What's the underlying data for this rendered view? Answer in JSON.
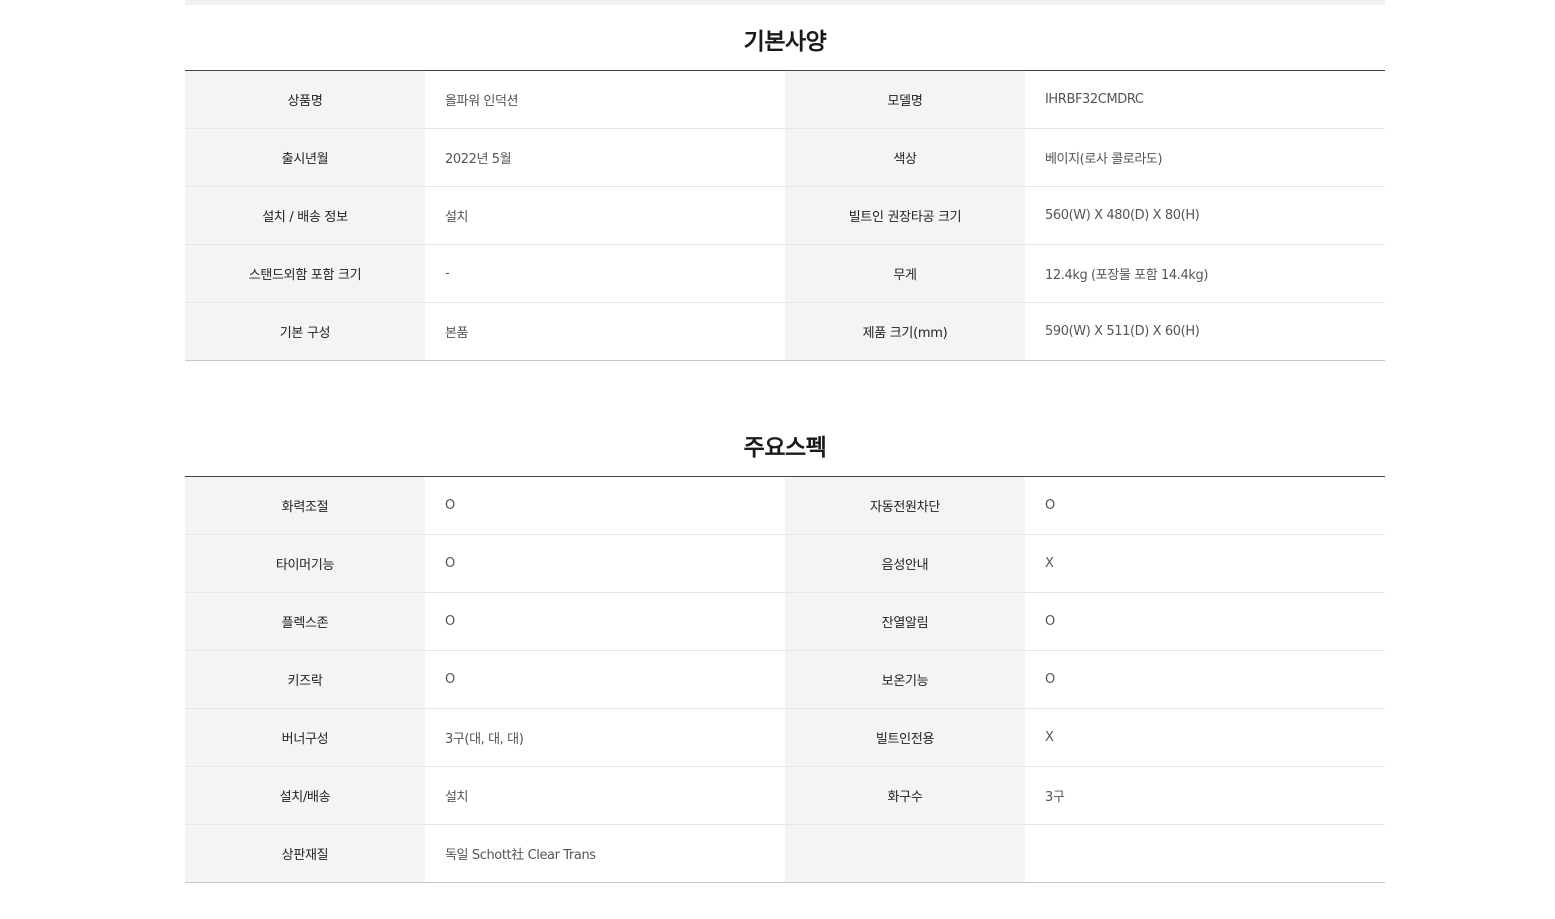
{
  "sections": {
    "basic": {
      "title": "기본사양",
      "rows": [
        {
          "l1": "상품명",
          "v1": "올파워 인덕션",
          "l2": "모델명",
          "v2": "IHRBF32CMDRC"
        },
        {
          "l1": "출시년월",
          "v1": "2022년 5월",
          "l2": "색상",
          "v2": "베이지(로사 콜로라도)"
        },
        {
          "l1": "설치 / 배송 정보",
          "v1": "설치",
          "l2": "빌트인 권장타공 크기",
          "v2": "560(W) X 480(D) X 80(H)"
        },
        {
          "l1": "스탠드외함 포함 크기",
          "v1": "-",
          "l2": "무게",
          "v2": "12.4kg (포장물 포함 14.4kg)"
        },
        {
          "l1": "기본 구성",
          "v1": "본품",
          "l2": "제품 크기(mm)",
          "v2": "590(W) X 511(D) X 60(H)"
        }
      ]
    },
    "main": {
      "title": "주요스펙",
      "rows": [
        {
          "l1": "화력조절",
          "v1": "O",
          "l2": "자동전원차단",
          "v2": "O"
        },
        {
          "l1": "타이머기능",
          "v1": "O",
          "l2": "음성안내",
          "v2": "X"
        },
        {
          "l1": "플렉스존",
          "v1": "O",
          "l2": "잔열알림",
          "v2": "O"
        },
        {
          "l1": "키즈락",
          "v1": "O",
          "l2": "보온기능",
          "v2": "O"
        },
        {
          "l1": "버너구성",
          "v1": "3구(대, 대, 대)",
          "l2": "빌트인전용",
          "v2": "X"
        },
        {
          "l1": "설치/배송",
          "v1": "설치",
          "l2": "화구수",
          "v2": "3구"
        },
        {
          "l1": "상판재질",
          "v1": "독일 Schott社 Clear Trans",
          "l2": "",
          "v2": ""
        }
      ]
    }
  }
}
